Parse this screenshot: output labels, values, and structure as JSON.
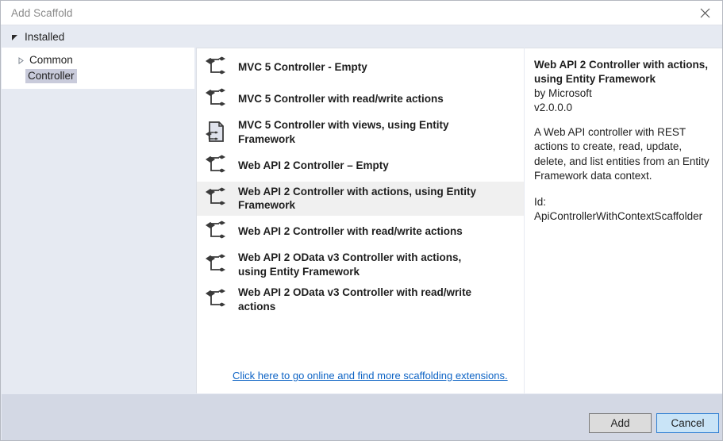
{
  "window": {
    "title": "Add Scaffold",
    "close_icon": "close-icon"
  },
  "installed_header": {
    "label": "Installed",
    "expander_icon": "triangle-expanded-icon"
  },
  "tree": {
    "items": [
      {
        "label": "Common",
        "expander_icon": "triangle-collapsed-icon",
        "selected": false
      },
      {
        "label": "Controller",
        "expander_icon": "none",
        "selected": true
      }
    ]
  },
  "list": {
    "items": [
      {
        "label": "MVC 5 Controller - Empty",
        "icon": "scaffold-node-icon",
        "selected": false
      },
      {
        "label": "MVC 5 Controller with read/write actions",
        "icon": "scaffold-node-icon",
        "selected": false
      },
      {
        "label": "MVC 5 Controller with views, using Entity Framework",
        "icon": "scaffold-page-icon",
        "selected": false
      },
      {
        "label": "Web API 2 Controller – Empty",
        "icon": "scaffold-node-icon",
        "selected": false
      },
      {
        "label": "Web API 2 Controller with actions, using Entity Framework",
        "icon": "scaffold-node-icon",
        "selected": true
      },
      {
        "label": "Web API 2 Controller with read/write actions",
        "icon": "scaffold-node-icon",
        "selected": false
      },
      {
        "label": "Web API 2 OData v3 Controller with actions, using Entity Framework",
        "icon": "scaffold-node-icon",
        "selected": false
      },
      {
        "label": "Web API 2 OData v3 Controller with read/write actions",
        "icon": "scaffold-node-icon",
        "selected": false
      }
    ],
    "extension_link": "Click here to go online and find more scaffolding extensions."
  },
  "details": {
    "title": "Web API 2 Controller with actions, using Entity Framework",
    "author": "by Microsoft",
    "version": "v2.0.0.0",
    "description": "A Web API controller with REST actions to create, read, update, delete, and list entities from an Entity Framework data context.",
    "id": "Id: ApiControllerWithContextScaffolder"
  },
  "footer": {
    "add_label": "Add",
    "cancel_label": "Cancel"
  },
  "colors": {
    "dialog_chrome": "#e6eaf2",
    "footer": "#d3d8e4",
    "selection_list": "#f0f0f0",
    "selection_tree": "#c9cbdb",
    "link": "#0b62c4",
    "cancel_button_bg": "#c9e4f7",
    "cancel_button_border": "#2d7dd2",
    "add_button_bg": "#dcdcdc"
  }
}
